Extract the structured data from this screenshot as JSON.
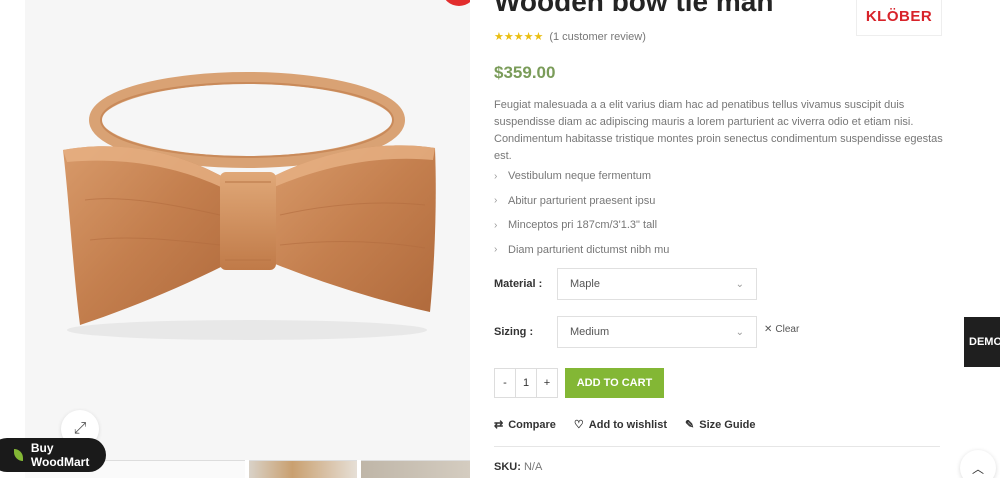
{
  "product": {
    "title": "Wooden bow tie man",
    "brand_logo_text": "KLÖBER",
    "rating": {
      "stars": 5,
      "stars_glyphs": "★★★★★",
      "review_text": "(1 customer review)"
    },
    "price": "$359.00",
    "description": "Feugiat malesuada a a elit varius diam hac ad penatibus tellus vivamus suscipit duis suspendisse diam ac adipiscing mauris a lorem parturient ac viverra odio et etiam nisi. Condimentum habitasse tristique montes proin senectus condimentum suspendisse egestas est.",
    "features": [
      "Vestibulum neque fermentum",
      "Abitur parturient praesent ipsu",
      "Minceptos pri 187cm/3'1.3\" tall",
      "Diam parturient dictumst nibh mu"
    ]
  },
  "variations": {
    "material": {
      "label": "Material :",
      "value": "Maple"
    },
    "sizing": {
      "label": "Sizing :",
      "value": "Medium"
    },
    "clear_label": "Clear"
  },
  "cart": {
    "minus": "-",
    "quantity": "1",
    "plus": "+",
    "add_to_cart_label": "ADD TO CART"
  },
  "actions": {
    "compare": "Compare",
    "wishlist": "Add to wishlist",
    "size_guide": "Size Guide"
  },
  "meta": {
    "sku_label": "SKU:",
    "sku_value": "N/A"
  },
  "floating": {
    "buy_label": "Buy WoodMart",
    "demo_label": "DEMO"
  },
  "colors": {
    "accent_green": "#83b735",
    "price_green": "#7a9c59",
    "star_yellow": "#eabe12",
    "brand_red": "#d8232a"
  }
}
